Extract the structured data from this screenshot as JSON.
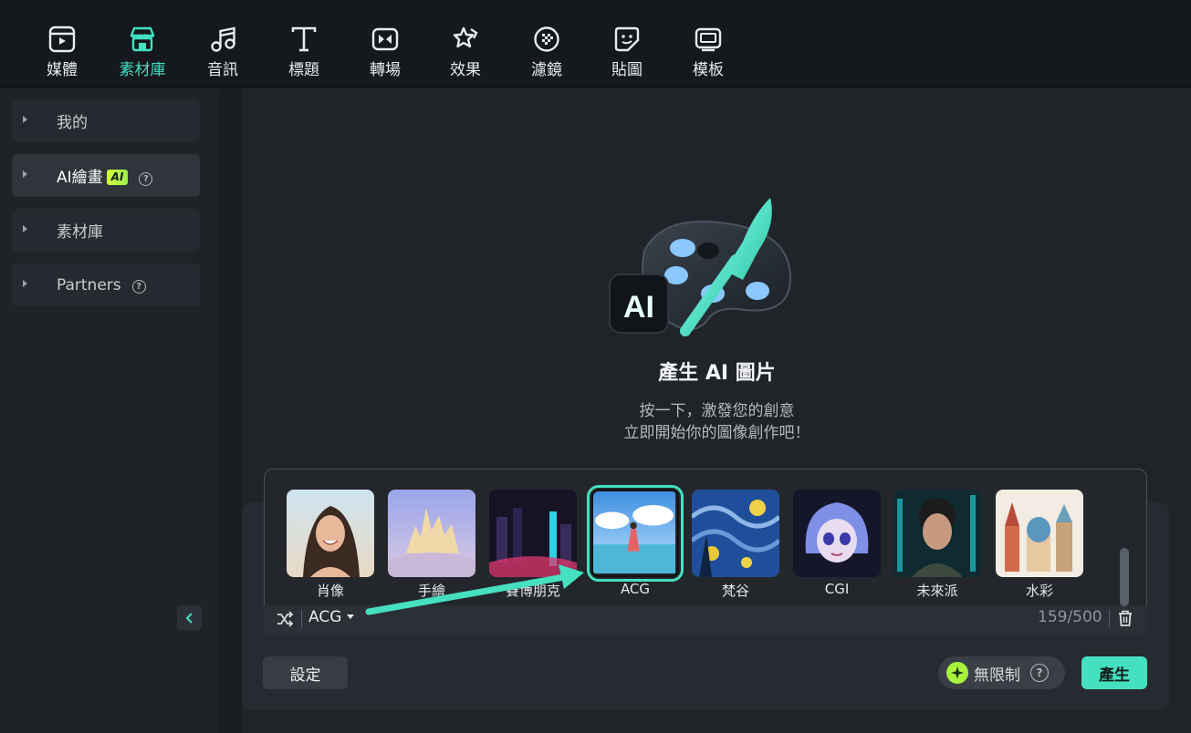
{
  "toolbar": {
    "tabs": [
      {
        "label": "媒體",
        "icon": "media-icon"
      },
      {
        "label": "素材庫",
        "icon": "store-icon",
        "active": true
      },
      {
        "label": "音訊",
        "icon": "music-note-icon"
      },
      {
        "label": "標題",
        "icon": "text-t-icon"
      },
      {
        "label": "轉場",
        "icon": "transition-icon"
      },
      {
        "label": "效果",
        "icon": "effects-star-icon"
      },
      {
        "label": "濾鏡",
        "icon": "filter-icon"
      },
      {
        "label": "貼圖",
        "icon": "sticker-icon"
      },
      {
        "label": "模板",
        "icon": "template-icon"
      }
    ]
  },
  "sidebar": {
    "items": [
      {
        "label": "我的"
      },
      {
        "label": "AI繪畫",
        "badge": "AI",
        "help": "?"
      },
      {
        "label": "素材庫"
      },
      {
        "label": "Partners",
        "help": "?"
      }
    ]
  },
  "hero": {
    "illustration_text": "AI",
    "title": "產生 AI 圖片",
    "subtitle_line1": "按一下，激發您的創意",
    "subtitle_line2": "立即開始你的圖像創作吧！"
  },
  "styles": [
    {
      "label": "肖像"
    },
    {
      "label": "手繪"
    },
    {
      "label": "賽博朋克"
    },
    {
      "label": "ACG",
      "selected": true
    },
    {
      "label": "梵谷"
    },
    {
      "label": "CGI"
    },
    {
      "label": "未來派"
    },
    {
      "label": "水彩"
    }
  ],
  "prompt": {
    "selected_style": "ACG",
    "char_count": "159/500"
  },
  "footer": {
    "settings_label": "設定",
    "unlimited_label": "無限制",
    "unlimited_help": "?",
    "generate_label": "產生"
  },
  "colors": {
    "accent": "#45e0c0",
    "badge": "#c8ff3a",
    "background": "#202429"
  }
}
